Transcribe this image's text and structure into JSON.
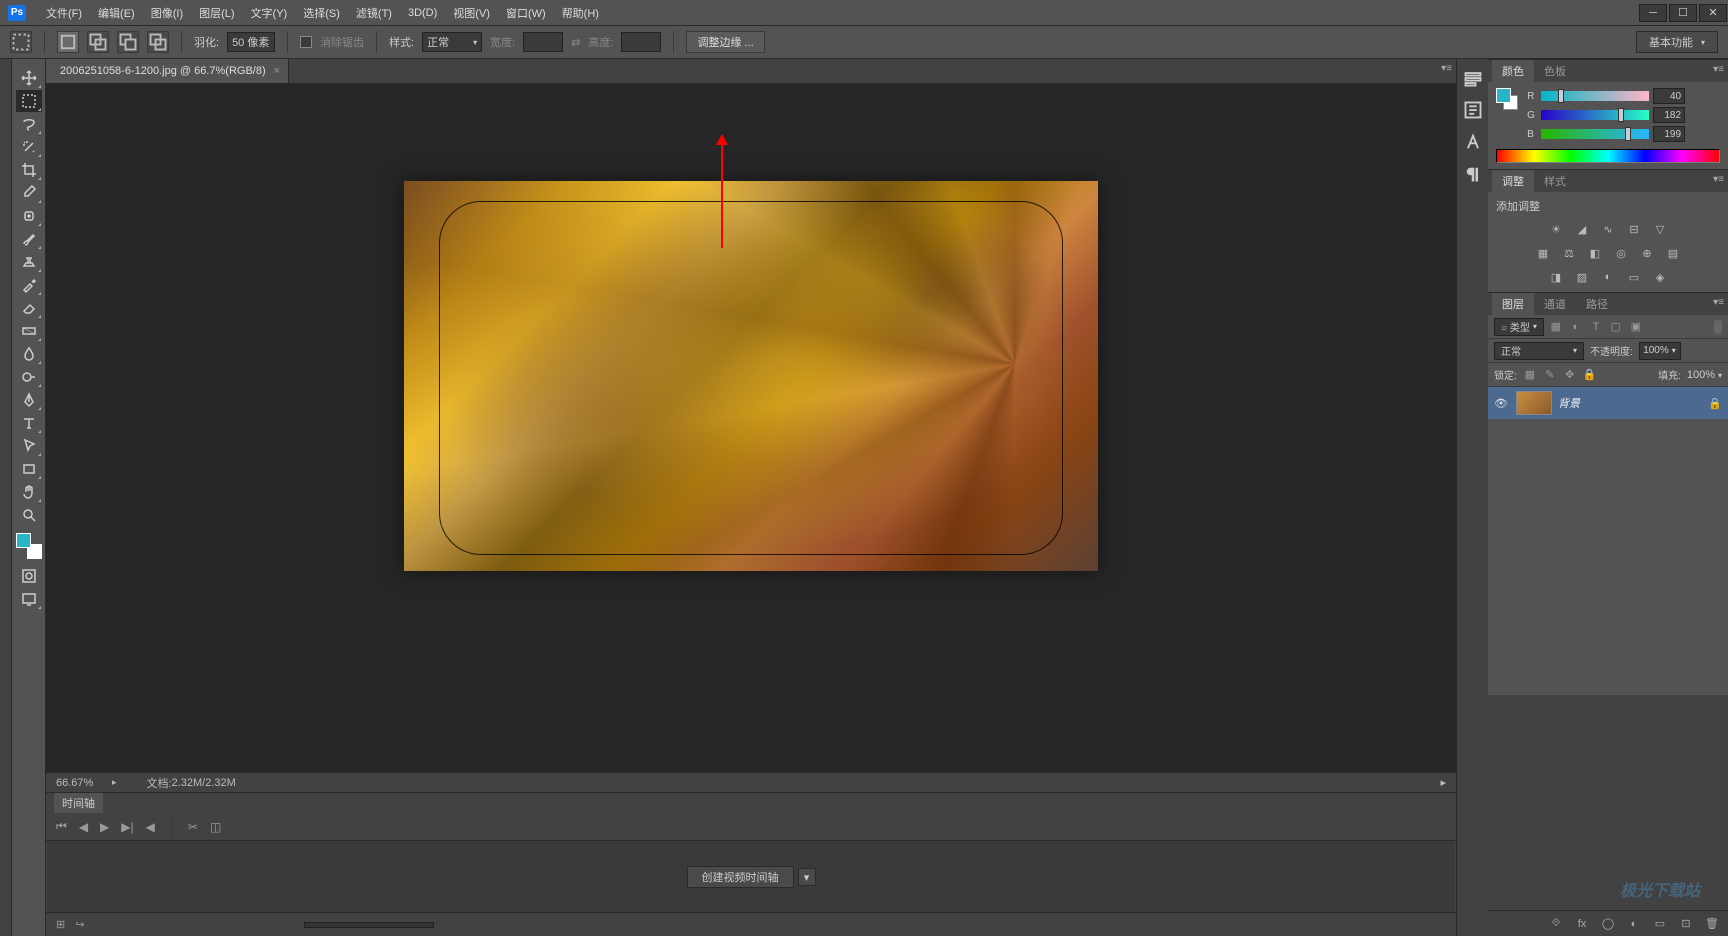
{
  "app": {
    "logo": "Ps"
  },
  "menubar": [
    "文件(F)",
    "编辑(E)",
    "图像(I)",
    "图层(L)",
    "文字(Y)",
    "选择(S)",
    "滤镜(T)",
    "3D(D)",
    "视图(V)",
    "窗口(W)",
    "帮助(H)"
  ],
  "options_bar": {
    "feather_label": "羽化:",
    "feather_value": "50 像素",
    "antialias_label": "消除锯齿",
    "style_label": "样式:",
    "style_value": "正常",
    "width_label": "宽度:",
    "height_label": "高度:",
    "refine_edge_label": "调整边缘 ...",
    "workspace_label": "基本功能"
  },
  "document": {
    "tab_title": "2006251058-6-1200.jpg @ 66.7%(RGB/8)",
    "zoom": "66.67%",
    "doc_info_label": "文档:",
    "doc_info_value": "2.32M/2.32M"
  },
  "timeline": {
    "tab_label": "时间轴",
    "create_button": "创建视频时间轴"
  },
  "color_panel": {
    "tab_color": "颜色",
    "tab_swatches": "色板",
    "channels": {
      "r": {
        "label": "R",
        "value": "40",
        "pct": 15.7
      },
      "g": {
        "label": "G",
        "value": "182",
        "pct": 71.4
      },
      "b": {
        "label": "B",
        "value": "199",
        "pct": 78.0
      }
    },
    "swatch_color": "#28b6c7"
  },
  "adjustments_panel": {
    "tab_adjust": "调整",
    "tab_styles": "样式",
    "header": "添加调整"
  },
  "layers_panel": {
    "tab_layers": "图层",
    "tab_channels": "通道",
    "tab_paths": "路径",
    "filter_kind_label": "○ 类型",
    "blend_mode": "正常",
    "opacity_label": "不透明度:",
    "opacity_value": "100%",
    "lock_label": "锁定:",
    "fill_label": "填充:",
    "fill_value": "100%",
    "layer_name": "背景"
  },
  "colors": {
    "bg": "#535353",
    "canvas_bg": "#262626",
    "accent": "#1473e6",
    "arrow": "#ff0000"
  }
}
